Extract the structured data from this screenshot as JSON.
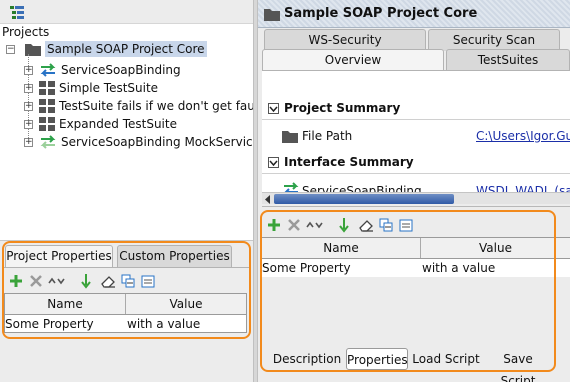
{
  "left_panel": {
    "projects_label": "Projects",
    "tree": {
      "root": "Sample SOAP Project Core",
      "items": [
        {
          "label": "ServiceSoapBinding",
          "icon": "interface-arrows-icon"
        },
        {
          "label": "Simple TestSuite",
          "icon": "testsuite-grid-icon"
        },
        {
          "label": "TestSuite fails if we don't get faults",
          "icon": "testsuite-grid-icon"
        },
        {
          "label": "Expanded TestSuite",
          "icon": "testsuite-grid-icon"
        },
        {
          "label": "ServiceSoapBinding MockService",
          "icon": "mockservice-arrows-icon"
        }
      ]
    },
    "properties": {
      "tabs": [
        "Project Properties",
        "Custom Properties"
      ],
      "selected_tab": "Project Properties",
      "columns": [
        "Name",
        "Value"
      ],
      "rows": [
        {
          "name": "Some Property",
          "value": "with a value"
        }
      ]
    }
  },
  "right_panel": {
    "title": "Sample SOAP Project Core",
    "tabs_row1": [
      "WS-Security Configurations",
      "Security Scan Defaults"
    ],
    "tabs_row2": [
      "Overview",
      "TestSuites"
    ],
    "selected_tab": "Overview",
    "sections": {
      "project_summary": "Project Summary",
      "file_path_label": "File Path",
      "file_path_value": "C:\\Users\\Igor.Gus",
      "interface_summary": "Interface Summary",
      "interface_name": "ServiceSoapBinding",
      "interface_link": "WSDL  WADL (sam"
    },
    "properties": {
      "columns": [
        "Name",
        "Value"
      ],
      "rows": [
        {
          "name": "Some Property",
          "value": "with a value"
        }
      ]
    },
    "bottom_tabs": [
      "Description",
      "Properties",
      "Load Script",
      "Save Script"
    ],
    "selected_bottom_tab": "Properties"
  },
  "colors": {
    "highlight": "#f28a1c",
    "title_bar": "#cfd8e4",
    "link": "#1b2fa8",
    "add_green": "#3aa33a"
  }
}
